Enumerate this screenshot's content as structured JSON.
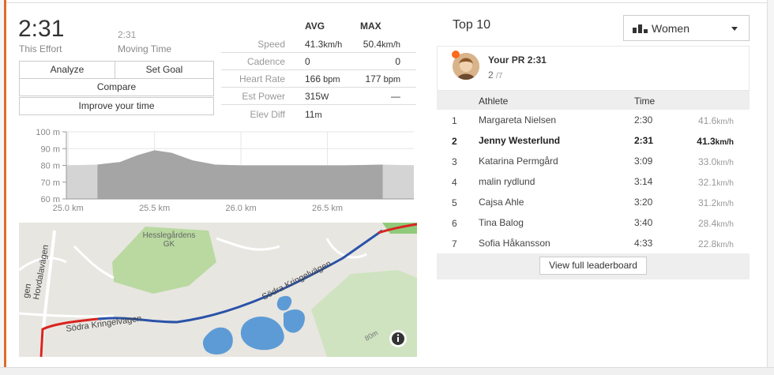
{
  "effort": {
    "time": "2:31",
    "time_label": "This Effort",
    "moving_time": "2:31",
    "moving_label": "Moving Time"
  },
  "buttons": {
    "analyze": "Analyze",
    "set_goal": "Set Goal",
    "compare": "Compare",
    "improve": "Improve your time"
  },
  "stats": {
    "avg_header": "AVG",
    "max_header": "MAX",
    "rows": [
      {
        "label": "Speed",
        "avg": "41.3",
        "avg_unit": "km/h",
        "max": "50.4",
        "max_unit": "km/h"
      },
      {
        "label": "Cadence",
        "avg": "0",
        "avg_unit": "",
        "max": "0",
        "max_unit": ""
      },
      {
        "label": "Heart Rate",
        "avg": "166",
        "avg_unit": " bpm",
        "max": "177",
        "max_unit": " bpm"
      },
      {
        "label": "Est Power",
        "avg": "315",
        "avg_unit": "W",
        "max": "—",
        "max_unit": ""
      },
      {
        "label": "Elev Diff",
        "avg": "11",
        "avg_unit": "m",
        "max": "",
        "max_unit": ""
      }
    ]
  },
  "chart_data": {
    "type": "area",
    "title": "",
    "xlabel": "",
    "ylabel": "",
    "y_ticks": [
      "100 m",
      "90 m",
      "80 m",
      "70 m",
      "60 m"
    ],
    "x_ticks": [
      "25.0 km",
      "25.5 km",
      "26.0 km",
      "26.5 km"
    ],
    "ylim": [
      60,
      100
    ],
    "xlim": [
      24.99,
      27.0
    ],
    "x": [
      24.99,
      25.17,
      25.3,
      25.4,
      25.5,
      25.6,
      25.72,
      25.85,
      26.0,
      26.3,
      26.6,
      26.82,
      27.0
    ],
    "y": [
      80,
      80.5,
      82,
      86,
      89,
      87.5,
      83,
      80.5,
      80,
      80,
      80,
      80.5,
      80
    ],
    "segment_highlight": [
      25.17,
      26.82
    ],
    "grid": true
  },
  "map": {
    "labels": {
      "hessle": "Hesslegårdens",
      "gk": "GK",
      "hovdala": "Hovdalavägen",
      "sodra1": "Södra Kringelvägen",
      "sodra2": "Södra Kringelvägen",
      "contour": "80m",
      "left_edge": "gen"
    },
    "colors": {
      "route_red": "#d9241f",
      "route_blue": "#2a52a8",
      "water": "#5d9bd6",
      "park": "#a9d08e"
    },
    "info_icon": "info-icon"
  },
  "leaderboard": {
    "title": "Top 10",
    "filter_label": "Women",
    "filter_icon": "bar-chart-icon",
    "pr_title": "Your PR 2:31",
    "pr_rank": "2",
    "pr_total": "/7",
    "headers": {
      "athlete": "Athlete",
      "time": "Time"
    },
    "rows": [
      {
        "rank": "1",
        "name": "Margareta Nielsen",
        "time": "2:30",
        "speed": "41.6",
        "unit": "km/h"
      },
      {
        "rank": "2",
        "name": "Jenny Westerlund",
        "time": "2:31",
        "speed": "41.3",
        "unit": "km/h"
      },
      {
        "rank": "3",
        "name": "Katarina Permgård",
        "time": "3:09",
        "speed": "33.0",
        "unit": "km/h"
      },
      {
        "rank": "4",
        "name": "malin rydlund",
        "time": "3:14",
        "speed": "32.1",
        "unit": "km/h"
      },
      {
        "rank": "5",
        "name": "Cajsa Ahle",
        "time": "3:20",
        "speed": "31.2",
        "unit": "km/h"
      },
      {
        "rank": "6",
        "name": "Tina Balog",
        "time": "3:40",
        "speed": "28.4",
        "unit": "km/h"
      },
      {
        "rank": "7",
        "name": "Sofia Håkansson",
        "time": "4:33",
        "speed": "22.8",
        "unit": "km/h"
      }
    ],
    "full_button": "View full leaderboard"
  }
}
